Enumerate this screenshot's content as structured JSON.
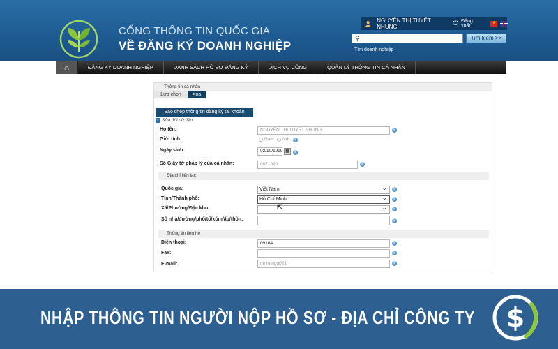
{
  "header": {
    "title_line1": "CỔNG THÔNG TIN QUỐC GIA",
    "title_line2": "VỀ ĐĂNG KÝ DOANH NGHIỆP",
    "user_name": "NGUYỄN THỊ TUYẾT NHUNG",
    "logout": "Đăng xuất",
    "search_button": "Tìm kiếm >>",
    "search_link": "Tìm doanh nghiệp",
    "search_value": ""
  },
  "nav": {
    "items": [
      "ĐĂNG KÝ DOANH NGHIỆP",
      "DANH SÁCH HỒ SƠ ĐĂNG KÝ",
      "DỊCH VỤ CÔNG",
      "QUẢN LÝ THÔNG TIN CÁ NHÂN"
    ]
  },
  "form": {
    "section_title": "Thông tin cá nhân",
    "tabs": [
      "Lựa chọn",
      "Xóa"
    ],
    "copy_button": "Sao chép thông tin đăng ký tài khoản",
    "edit_checkbox": "Sửa đổi dữ liệu",
    "labels": {
      "name": "Họ tên:",
      "gender": "Giới tính:",
      "dob": "Ngày sinh:",
      "id": "Số Giấy tờ pháp lý của cá nhân:",
      "country": "Quốc gia:",
      "province": "Tỉnh/Thành phố:",
      "ward": "Xã/Phường/Đặc khu:",
      "street": "Số nhà/đường/phố/tổ/xóm/ấp/thôn:",
      "phone": "Điện thoại:",
      "fax": "Fax:",
      "email": "E-mail:"
    },
    "values": {
      "name": "NGUYỄN THỊ TUYẾT NHUNG",
      "gender_male": "Nam",
      "gender_female": "Nữ",
      "dob": "02/10/1999",
      "id": "0871990",
      "country": "Việt Nam",
      "province": "Hồ Chí Minh",
      "ward": "",
      "street": "",
      "phone": "09164",
      "fax": "",
      "email": "ntnhungg021"
    },
    "address_section": "Địa chỉ liên lạc",
    "contact_section": "Thông tin liên hệ"
  },
  "banner": {
    "text": "NHẬP THÔNG TIN NGƯỜI NỘP HỒ SƠ - ĐỊA CHỈ CÔNG TY"
  },
  "colors": {
    "header_blue": "#1e5b92",
    "banner_blue": "#2d5f91",
    "tab_active": "#14405f",
    "nav_dark": "#111111"
  }
}
